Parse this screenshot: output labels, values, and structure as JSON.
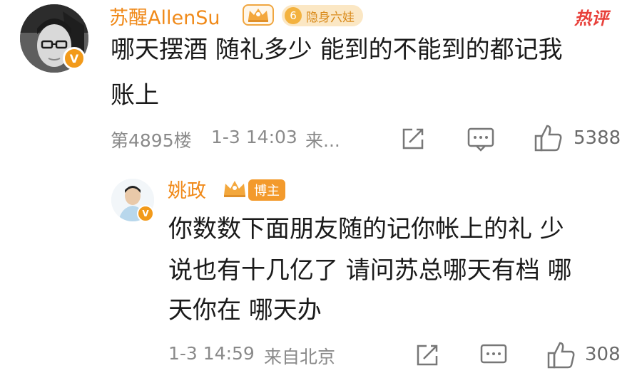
{
  "comment": {
    "username": "苏醒AllenSu",
    "level": "6",
    "level_label": "隐身六娃",
    "hot_tag": "热评",
    "text_line1": "哪天摆酒  随礼多少  能到的不能到的都记我",
    "text_line2": "账上",
    "floor": "第4895楼",
    "time": "1-3 14:03",
    "source": "来...",
    "likes": "5388",
    "verified": "V"
  },
  "reply": {
    "username": "姚政",
    "badge": "博主",
    "text_line1": "你数数下面朋友随的记你帐上的礼  少",
    "text_line2": "说也有十几亿了  请问苏总哪天有档  哪",
    "text_line3": "天你在  哪天办",
    "time": "1-3 14:59",
    "source": "来自北京",
    "likes": "308",
    "verified": "V"
  },
  "colors": {
    "username": "#f08a1a",
    "hot": "#e8403a",
    "meta": "#8a8a8a",
    "badge_orange": "#f39a2c"
  }
}
